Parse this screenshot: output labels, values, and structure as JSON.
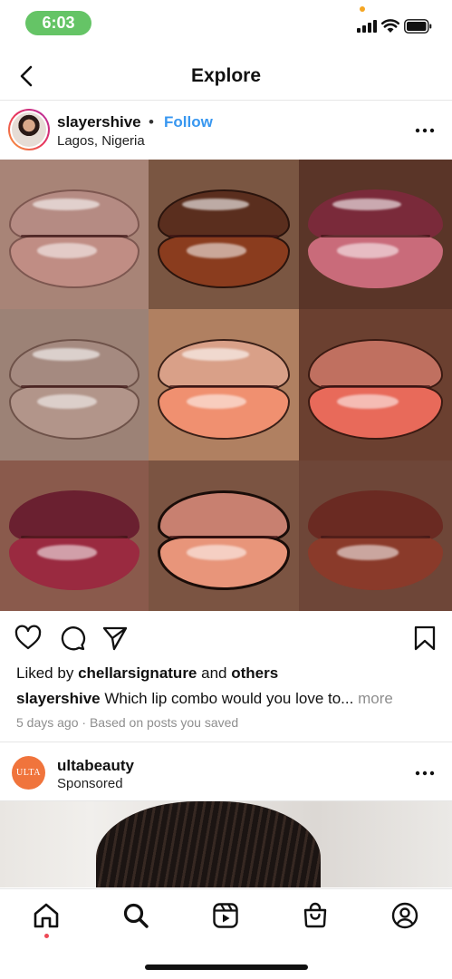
{
  "status_bar": {
    "time": "6:03"
  },
  "header": {
    "title": "Explore"
  },
  "post": {
    "username": "slayershive",
    "separator": "•",
    "follow_label": "Follow",
    "location": "Lagos, Nigeria",
    "photo_description_icon": "lip-collage-photo",
    "likes": {
      "prefix": "Liked by",
      "user": "chellarsignature",
      "and": "and",
      "others": "others"
    },
    "caption": {
      "username": "slayershive",
      "text": "Which lip combo would you love to...",
      "more": "more"
    },
    "meta": {
      "time": "5 days ago",
      "sep": "·",
      "reason": "Based on posts you saved"
    }
  },
  "sponsored": {
    "logo_text": "ULTA",
    "username": "ultabeauty",
    "label": "Sponsored"
  },
  "colors": {
    "follow": "#3897f0",
    "time_pill": "#65c466",
    "notification": "#ed4956",
    "ulta": "#f0743c"
  },
  "icons": {
    "actions": [
      "heart-icon",
      "comment-icon",
      "share-icon",
      "bookmark-icon"
    ],
    "tabs": [
      "home-icon",
      "search-icon",
      "reels-icon",
      "shop-icon",
      "profile-icon"
    ]
  }
}
